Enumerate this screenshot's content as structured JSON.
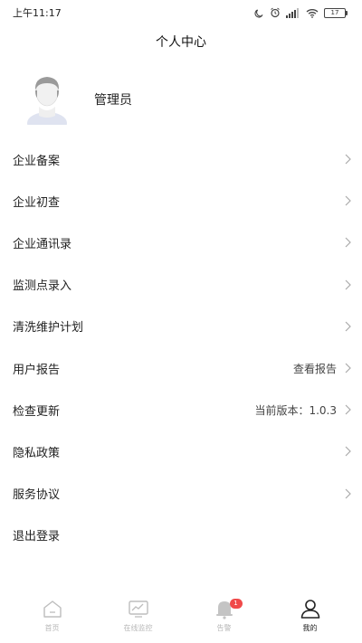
{
  "status_bar": {
    "time": "上午11:17",
    "battery": "17"
  },
  "header": {
    "title": "个人中心"
  },
  "profile": {
    "name": "管理员"
  },
  "menu": {
    "items": [
      {
        "label": "企业备案",
        "value": "",
        "chevron": true
      },
      {
        "label": "企业初查",
        "value": "",
        "chevron": true
      },
      {
        "label": "企业通讯录",
        "value": "",
        "chevron": true
      },
      {
        "label": "监测点录入",
        "value": "",
        "chevron": true
      },
      {
        "label": "清洗维护计划",
        "value": "",
        "chevron": true
      },
      {
        "label": "用户报告",
        "value": "查看报告",
        "chevron": true
      },
      {
        "label": "检查更新",
        "value": "当前版本：1.0.3",
        "chevron": true
      },
      {
        "label": "隐私政策",
        "value": "",
        "chevron": true
      },
      {
        "label": "服务协议",
        "value": "",
        "chevron": true
      },
      {
        "label": "退出登录",
        "value": "",
        "chevron": false
      }
    ]
  },
  "bottom_nav": {
    "items": [
      {
        "label": "首页",
        "icon": "home-icon",
        "active": false
      },
      {
        "label": "在线监控",
        "icon": "monitor-icon",
        "active": false
      },
      {
        "label": "告警",
        "icon": "bell-icon",
        "active": false,
        "badge": "1"
      },
      {
        "label": "我的",
        "icon": "user-icon",
        "active": true
      }
    ]
  },
  "colors": {
    "badge": "#f04a4a",
    "inactive_nav": "#b8b8b8",
    "active_nav": "#222222"
  }
}
